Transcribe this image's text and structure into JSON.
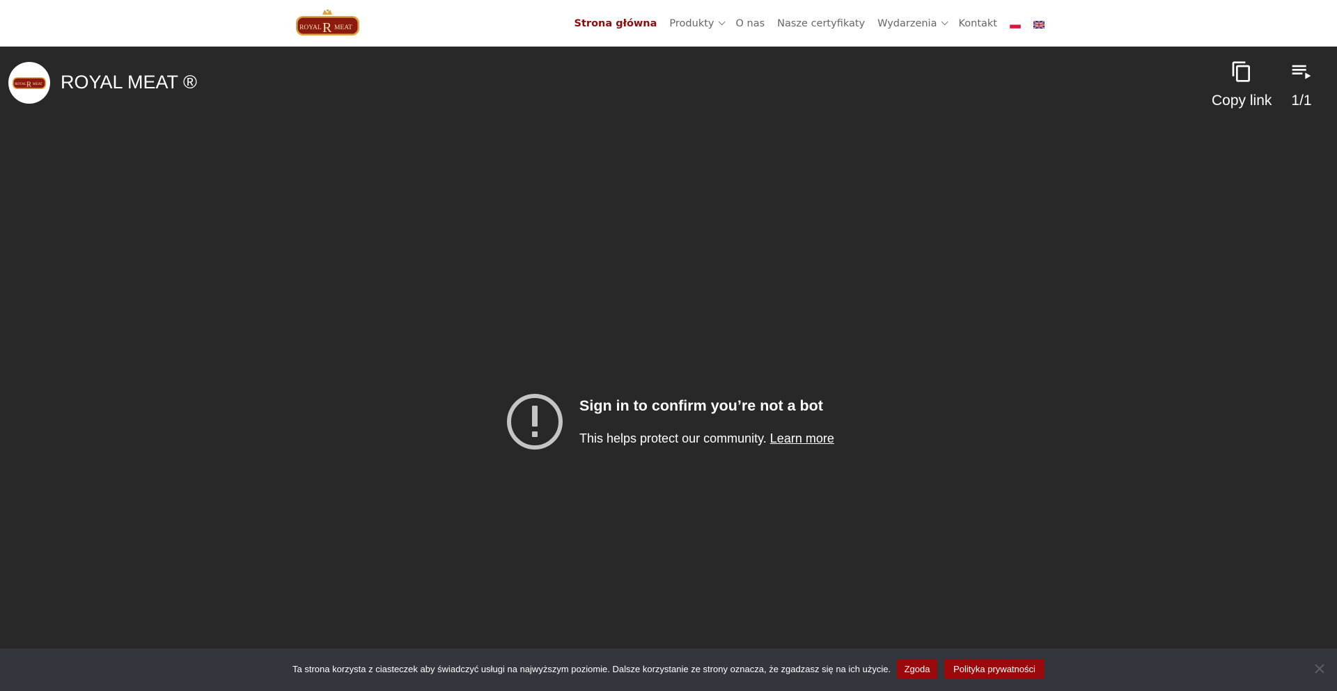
{
  "site": {
    "logo": {
      "text_left": "ROYAL",
      "letter": "R",
      "text_right": "MEAT"
    },
    "nav": [
      {
        "label": "Strona główna",
        "active": true,
        "dropdown": false
      },
      {
        "label": "Produkty",
        "active": false,
        "dropdown": true
      },
      {
        "label": "O nas",
        "active": false,
        "dropdown": false
      },
      {
        "label": "Nasze certyfikaty",
        "active": false,
        "dropdown": false
      },
      {
        "label": "Wydarzenia",
        "active": false,
        "dropdown": true
      },
      {
        "label": "Kontakt",
        "active": false,
        "dropdown": false
      }
    ],
    "languages": [
      "polish-flag-icon",
      "english-flag-icon"
    ],
    "accent_color": "#8b0d0d"
  },
  "player": {
    "channel_title": "ROYAL MEAT ®",
    "copy_link_label": "Copy link",
    "playlist_counter": "1/1",
    "error": {
      "title": "Sign in to confirm you’re not a bot",
      "message": "This helps protect our community.",
      "link": "Learn more"
    },
    "background_color": "#282828"
  },
  "cookie": {
    "text": "Ta strona korzysta z ciasteczek aby świadczyć usługi na najwyższym poziomie. Dalsze korzystanie ze strony oznacza, że zgadzasz się na ich użycie.",
    "accept_label": "Zgoda",
    "policy_label": "Polityka prywatności",
    "button_color": "#9b0a0a"
  }
}
